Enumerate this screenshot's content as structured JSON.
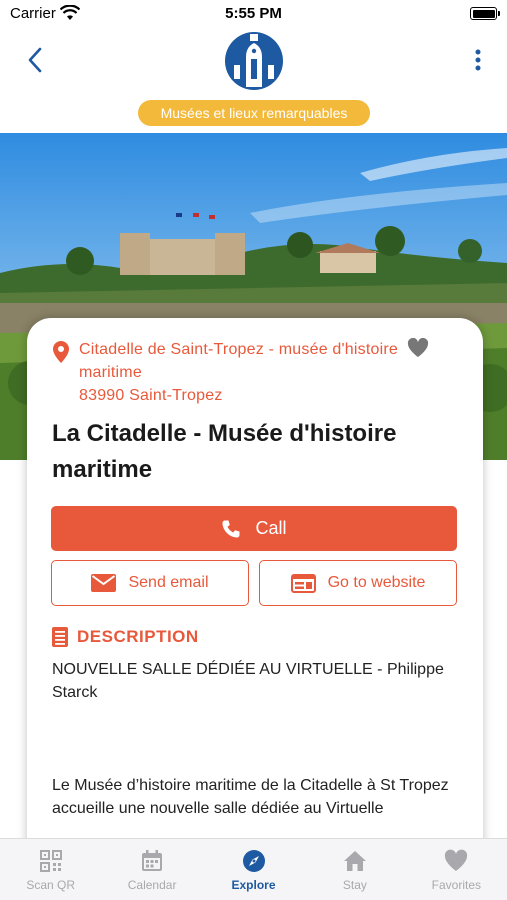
{
  "status_bar": {
    "carrier": "Carrier",
    "time": "5:55 PM"
  },
  "header": {
    "category": "Musées et lieux remarquables"
  },
  "place": {
    "address_line1": "Citadelle de Saint-Tropez - musée d'histoire maritime",
    "address_line2": "83990 Saint-Tropez",
    "title": "La Citadelle - Musée d'histoire maritime"
  },
  "actions": {
    "call_label": "Call",
    "email_label": "Send email",
    "website_label": "Go to website"
  },
  "description": {
    "heading": "DESCRIPTION",
    "subtitle": "NOUVELLE SALLE DÉDIÉE AU VIRTUELLE - Philippe Starck",
    "body": "Le Musée d’histoire maritime de la Citadelle à St Tropez accueille une nouvelle salle dédiée au Virtuelle"
  },
  "tabs": [
    {
      "label": "Scan QR",
      "icon": "qr-code-icon"
    },
    {
      "label": "Calendar",
      "icon": "calendar-icon"
    },
    {
      "label": "Explore",
      "icon": "compass-icon",
      "active": true
    },
    {
      "label": "Stay",
      "icon": "home-icon"
    },
    {
      "label": "Favorites",
      "icon": "heart-icon"
    }
  ],
  "colors": {
    "accent": "#e8593b",
    "brand": "#1d5aa1",
    "badge": "#f3b93b",
    "inactive_tab": "#a9a9ad"
  }
}
